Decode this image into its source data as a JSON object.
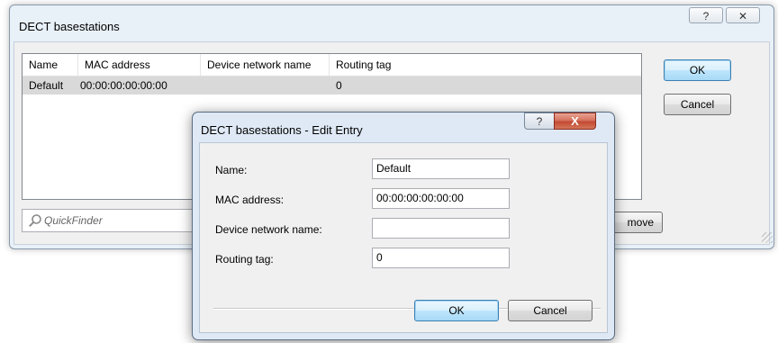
{
  "main_dialog": {
    "title": "DECT basestations",
    "help_glyph": "?",
    "close_glyph": "✕",
    "columns": [
      "Name",
      "MAC address",
      "Device network name",
      "Routing tag"
    ],
    "rows": [
      {
        "name": "Default",
        "mac": "00:00:00:00:00:00",
        "device_network_name": "",
        "routing_tag": "0"
      }
    ],
    "ok_label": "OK",
    "cancel_label": "Cancel",
    "remove_label_visible": "move",
    "quickfinder_placeholder": "QuickFinder",
    "quickfinder_icon": "search-icon"
  },
  "edit_dialog": {
    "title": "DECT basestations - Edit Entry",
    "help_glyph": "?",
    "close_glyph": "X",
    "fields": [
      {
        "label": "Name:",
        "value": "Default"
      },
      {
        "label": "MAC address:",
        "value": "00:00:00:00:00:00"
      },
      {
        "label": "Device network name:",
        "value": ""
      },
      {
        "label": "Routing tag:",
        "value": "0"
      }
    ],
    "ok_label": "OK",
    "cancel_label": "Cancel"
  },
  "colors": {
    "selected_row": "#d9d9d9",
    "close_button": "#c44a32",
    "default_button_border": "#3c7fb1"
  }
}
